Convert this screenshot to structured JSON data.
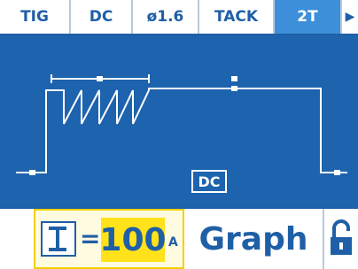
{
  "tabs": [
    {
      "label": "TIG",
      "active": false
    },
    {
      "label": "DC",
      "active": false
    },
    {
      "label": "ø1.6",
      "active": false
    },
    {
      "label": "TACK",
      "active": false
    },
    {
      "label": "2T",
      "active": true
    }
  ],
  "next_icon": "right-triangle-icon",
  "graph_badge": "DC",
  "current": {
    "symbol_icon": "current-I-icon",
    "equals": "=",
    "value": "100",
    "unit": "A"
  },
  "mode_label": "Graph",
  "lock_icon": "padlock-unlocked-icon",
  "colors": {
    "primary": "#1f5fa6",
    "screen": "#1d63ad",
    "active_tab": "#3d8fd9",
    "highlight": "#ffe21a"
  }
}
